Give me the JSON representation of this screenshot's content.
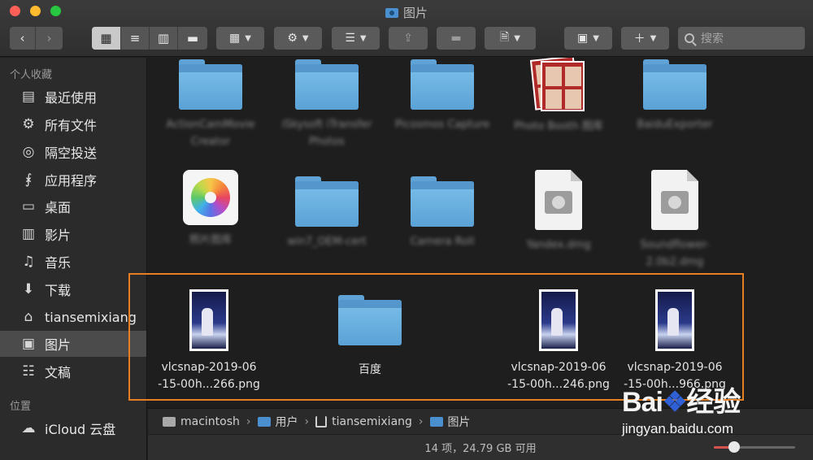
{
  "window": {
    "title": "图片"
  },
  "toolbar": {
    "back_icon": "chevron-left-icon",
    "forward_icon": "chevron-right-icon",
    "view_modes": [
      "icon-view-icon",
      "list-view-icon",
      "column-view-icon",
      "gallery-view-icon"
    ],
    "search_placeholder": "搜索"
  },
  "sidebar": {
    "favorites_header": "个人收藏",
    "locations_header": "位置",
    "items": [
      {
        "label": "最近使用",
        "icon": "recents-icon"
      },
      {
        "label": "所有文件",
        "icon": "gear-icon"
      },
      {
        "label": "隔空投送",
        "icon": "airdrop-icon"
      },
      {
        "label": "应用程序",
        "icon": "applications-icon"
      },
      {
        "label": "桌面",
        "icon": "desktop-icon"
      },
      {
        "label": "影片",
        "icon": "film-icon"
      },
      {
        "label": "音乐",
        "icon": "music-note-icon"
      },
      {
        "label": "下载",
        "icon": "download-icon"
      },
      {
        "label": "tiansemixiang",
        "icon": "home-icon"
      },
      {
        "label": "图片",
        "icon": "camera-icon",
        "selected": true
      },
      {
        "label": "文稿",
        "icon": "document-icon"
      }
    ],
    "locations": [
      {
        "label": "iCloud 云盘",
        "icon": "cloud-icon"
      }
    ]
  },
  "files": {
    "row1": [
      {
        "name": "ActionCamMovie Creator",
        "kind": "folder",
        "blurred": true
      },
      {
        "name": "iSkysoft iTransfer Photos",
        "kind": "folder",
        "blurred": true
      },
      {
        "name": "Picosmos Capture",
        "kind": "folder",
        "blurred": true
      },
      {
        "name": "Photo Booth 图库",
        "kind": "photobooth",
        "blurred": true
      },
      {
        "name": "BaiduExporter",
        "kind": "folder",
        "blurred": true
      }
    ],
    "row2": [
      {
        "name": "照片图库",
        "kind": "photos",
        "blurred": true
      },
      {
        "name": "win7_OEM-cert",
        "kind": "folder",
        "blurred": true
      },
      {
        "name": "Camera Roll",
        "kind": "folder",
        "blurred": true
      },
      {
        "name": "Yandex.dmg",
        "kind": "dmg",
        "blurred": true
      },
      {
        "name": "Soundflower-2.0b2.dmg",
        "kind": "dmg",
        "blurred": true
      }
    ],
    "row3": [
      {
        "line1": "vlcsnap-2019-06",
        "line2": "-15-00h...266.png",
        "kind": "image"
      },
      {
        "line1": "百度",
        "line2": "",
        "kind": "folder"
      },
      {
        "line1": "vlcsnap-2019-06",
        "line2": "-15-00h...246.png",
        "kind": "image"
      },
      {
        "line1": "vlcsnap-2019-06",
        "line2": "-15-00h...966.png",
        "kind": "image"
      }
    ]
  },
  "pathbar": {
    "segments": [
      "macintosh",
      "用户",
      "tiansemixiang",
      "图片"
    ]
  },
  "statusbar": {
    "text": "14 项，24.79 GB 可用",
    "zoom_level": 0.25
  },
  "watermark": {
    "logo_text": "Bai",
    "logo_text2": "经验",
    "site": "jingyan.baidu.com"
  },
  "colors": {
    "highlight": "#e67e22",
    "folder": "#6db3e3",
    "selected_sidebar": "#4b4b4b"
  }
}
